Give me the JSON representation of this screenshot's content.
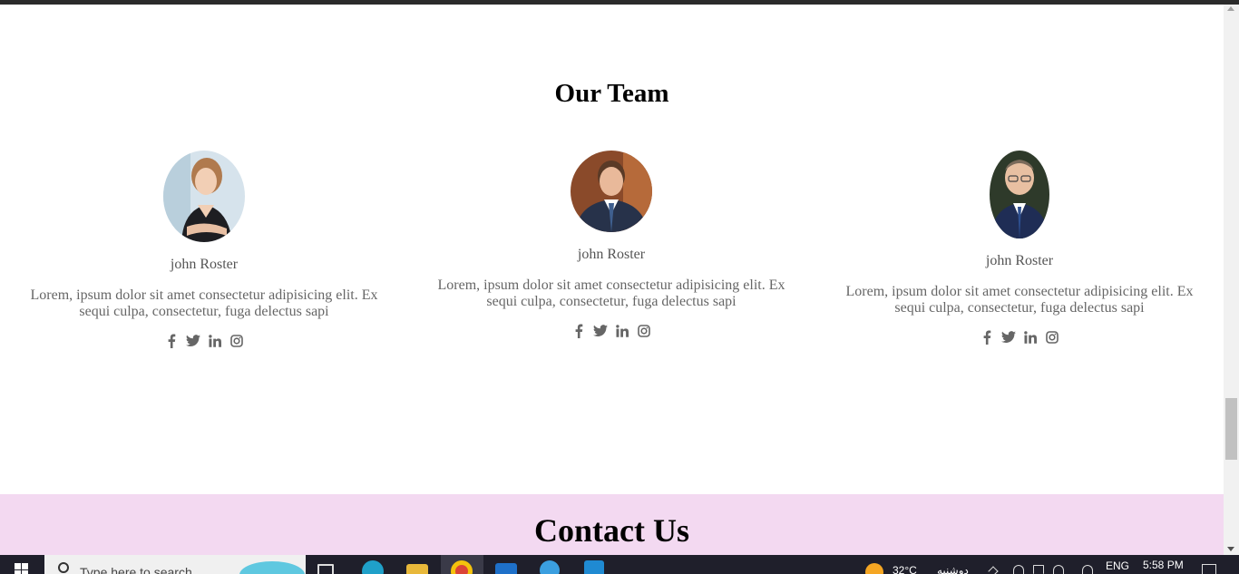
{
  "team": {
    "title": "Our Team",
    "members": [
      {
        "name": "john Roster",
        "description": "Lorem, ipsum dolor sit amet consectetur adipisicing elit. Ex sequi culpa, consectetur, fuga delectus sapi"
      },
      {
        "name": "john Roster",
        "description": "Lorem, ipsum dolor sit amet consectetur adipisicing elit. Ex sequi culpa, consectetur, fuga delectus sapi"
      },
      {
        "name": "john Roster",
        "description": "Lorem, ipsum dolor sit amet consectetur adipisicing elit. Ex sequi culpa, consectetur, fuga delectus sapi"
      }
    ],
    "social_icons": [
      "facebook-icon",
      "twitter-icon",
      "linkedin-icon",
      "instagram-icon"
    ]
  },
  "contact": {
    "title": "Contact Us",
    "background": "#f3d9f1"
  },
  "taskbar": {
    "search_placeholder": "Type here to search",
    "temperature": "32°C",
    "weather_text": "دوشنبه",
    "language": "ENG",
    "time": "5:58 PM",
    "apps": [
      "task-view-icon",
      "edge-icon",
      "file-explorer-icon",
      "chrome-icon",
      "mail-icon",
      "internet-explorer-icon",
      "vscode-icon"
    ]
  },
  "colors": {
    "text_muted": "#666666",
    "heading": "#000000",
    "taskbar": "#1f1f2b"
  }
}
